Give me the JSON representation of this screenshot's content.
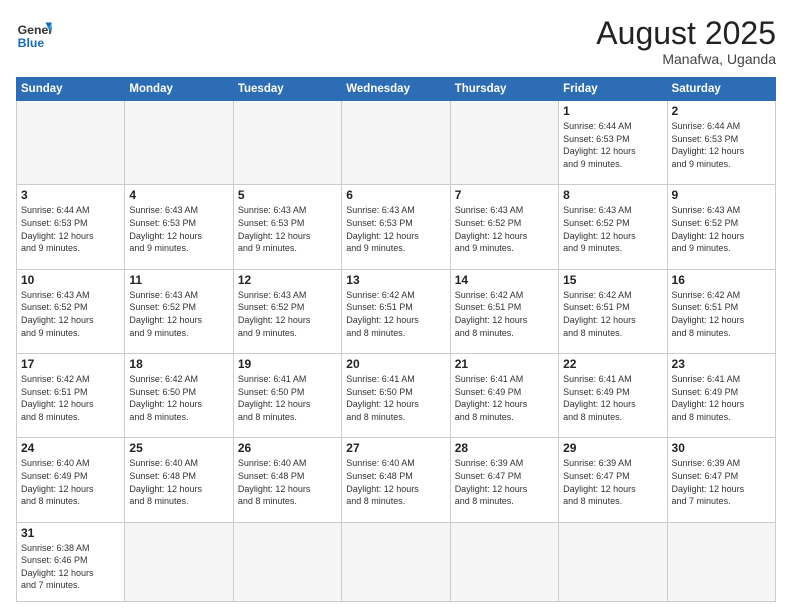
{
  "header": {
    "logo_general": "General",
    "logo_blue": "Blue",
    "title": "August 2025",
    "subtitle": "Manafwa, Uganda"
  },
  "days_of_week": [
    "Sunday",
    "Monday",
    "Tuesday",
    "Wednesday",
    "Thursday",
    "Friday",
    "Saturday"
  ],
  "weeks": [
    [
      {
        "day": "",
        "info": "",
        "empty": true
      },
      {
        "day": "",
        "info": "",
        "empty": true
      },
      {
        "day": "",
        "info": "",
        "empty": true
      },
      {
        "day": "",
        "info": "",
        "empty": true
      },
      {
        "day": "",
        "info": "",
        "empty": true
      },
      {
        "day": "1",
        "info": "Sunrise: 6:44 AM\nSunset: 6:53 PM\nDaylight: 12 hours\nand 9 minutes."
      },
      {
        "day": "2",
        "info": "Sunrise: 6:44 AM\nSunset: 6:53 PM\nDaylight: 12 hours\nand 9 minutes."
      }
    ],
    [
      {
        "day": "3",
        "info": "Sunrise: 6:44 AM\nSunset: 6:53 PM\nDaylight: 12 hours\nand 9 minutes."
      },
      {
        "day": "4",
        "info": "Sunrise: 6:43 AM\nSunset: 6:53 PM\nDaylight: 12 hours\nand 9 minutes."
      },
      {
        "day": "5",
        "info": "Sunrise: 6:43 AM\nSunset: 6:53 PM\nDaylight: 12 hours\nand 9 minutes."
      },
      {
        "day": "6",
        "info": "Sunrise: 6:43 AM\nSunset: 6:53 PM\nDaylight: 12 hours\nand 9 minutes."
      },
      {
        "day": "7",
        "info": "Sunrise: 6:43 AM\nSunset: 6:52 PM\nDaylight: 12 hours\nand 9 minutes."
      },
      {
        "day": "8",
        "info": "Sunrise: 6:43 AM\nSunset: 6:52 PM\nDaylight: 12 hours\nand 9 minutes."
      },
      {
        "day": "9",
        "info": "Sunrise: 6:43 AM\nSunset: 6:52 PM\nDaylight: 12 hours\nand 9 minutes."
      }
    ],
    [
      {
        "day": "10",
        "info": "Sunrise: 6:43 AM\nSunset: 6:52 PM\nDaylight: 12 hours\nand 9 minutes."
      },
      {
        "day": "11",
        "info": "Sunrise: 6:43 AM\nSunset: 6:52 PM\nDaylight: 12 hours\nand 9 minutes."
      },
      {
        "day": "12",
        "info": "Sunrise: 6:43 AM\nSunset: 6:52 PM\nDaylight: 12 hours\nand 9 minutes."
      },
      {
        "day": "13",
        "info": "Sunrise: 6:42 AM\nSunset: 6:51 PM\nDaylight: 12 hours\nand 8 minutes."
      },
      {
        "day": "14",
        "info": "Sunrise: 6:42 AM\nSunset: 6:51 PM\nDaylight: 12 hours\nand 8 minutes."
      },
      {
        "day": "15",
        "info": "Sunrise: 6:42 AM\nSunset: 6:51 PM\nDaylight: 12 hours\nand 8 minutes."
      },
      {
        "day": "16",
        "info": "Sunrise: 6:42 AM\nSunset: 6:51 PM\nDaylight: 12 hours\nand 8 minutes."
      }
    ],
    [
      {
        "day": "17",
        "info": "Sunrise: 6:42 AM\nSunset: 6:51 PM\nDaylight: 12 hours\nand 8 minutes."
      },
      {
        "day": "18",
        "info": "Sunrise: 6:42 AM\nSunset: 6:50 PM\nDaylight: 12 hours\nand 8 minutes."
      },
      {
        "day": "19",
        "info": "Sunrise: 6:41 AM\nSunset: 6:50 PM\nDaylight: 12 hours\nand 8 minutes."
      },
      {
        "day": "20",
        "info": "Sunrise: 6:41 AM\nSunset: 6:50 PM\nDaylight: 12 hours\nand 8 minutes."
      },
      {
        "day": "21",
        "info": "Sunrise: 6:41 AM\nSunset: 6:49 PM\nDaylight: 12 hours\nand 8 minutes."
      },
      {
        "day": "22",
        "info": "Sunrise: 6:41 AM\nSunset: 6:49 PM\nDaylight: 12 hours\nand 8 minutes."
      },
      {
        "day": "23",
        "info": "Sunrise: 6:41 AM\nSunset: 6:49 PM\nDaylight: 12 hours\nand 8 minutes."
      }
    ],
    [
      {
        "day": "24",
        "info": "Sunrise: 6:40 AM\nSunset: 6:49 PM\nDaylight: 12 hours\nand 8 minutes."
      },
      {
        "day": "25",
        "info": "Sunrise: 6:40 AM\nSunset: 6:48 PM\nDaylight: 12 hours\nand 8 minutes."
      },
      {
        "day": "26",
        "info": "Sunrise: 6:40 AM\nSunset: 6:48 PM\nDaylight: 12 hours\nand 8 minutes."
      },
      {
        "day": "27",
        "info": "Sunrise: 6:40 AM\nSunset: 6:48 PM\nDaylight: 12 hours\nand 8 minutes."
      },
      {
        "day": "28",
        "info": "Sunrise: 6:39 AM\nSunset: 6:47 PM\nDaylight: 12 hours\nand 8 minutes."
      },
      {
        "day": "29",
        "info": "Sunrise: 6:39 AM\nSunset: 6:47 PM\nDaylight: 12 hours\nand 8 minutes."
      },
      {
        "day": "30",
        "info": "Sunrise: 6:39 AM\nSunset: 6:47 PM\nDaylight: 12 hours\nand 7 minutes."
      }
    ],
    [
      {
        "day": "31",
        "info": "Sunrise: 6:38 AM\nSunset: 6:46 PM\nDaylight: 12 hours\nand 7 minutes."
      },
      {
        "day": "",
        "info": "",
        "empty": true
      },
      {
        "day": "",
        "info": "",
        "empty": true
      },
      {
        "day": "",
        "info": "",
        "empty": true
      },
      {
        "day": "",
        "info": "",
        "empty": true
      },
      {
        "day": "",
        "info": "",
        "empty": true
      },
      {
        "day": "",
        "info": "",
        "empty": true
      }
    ]
  ]
}
